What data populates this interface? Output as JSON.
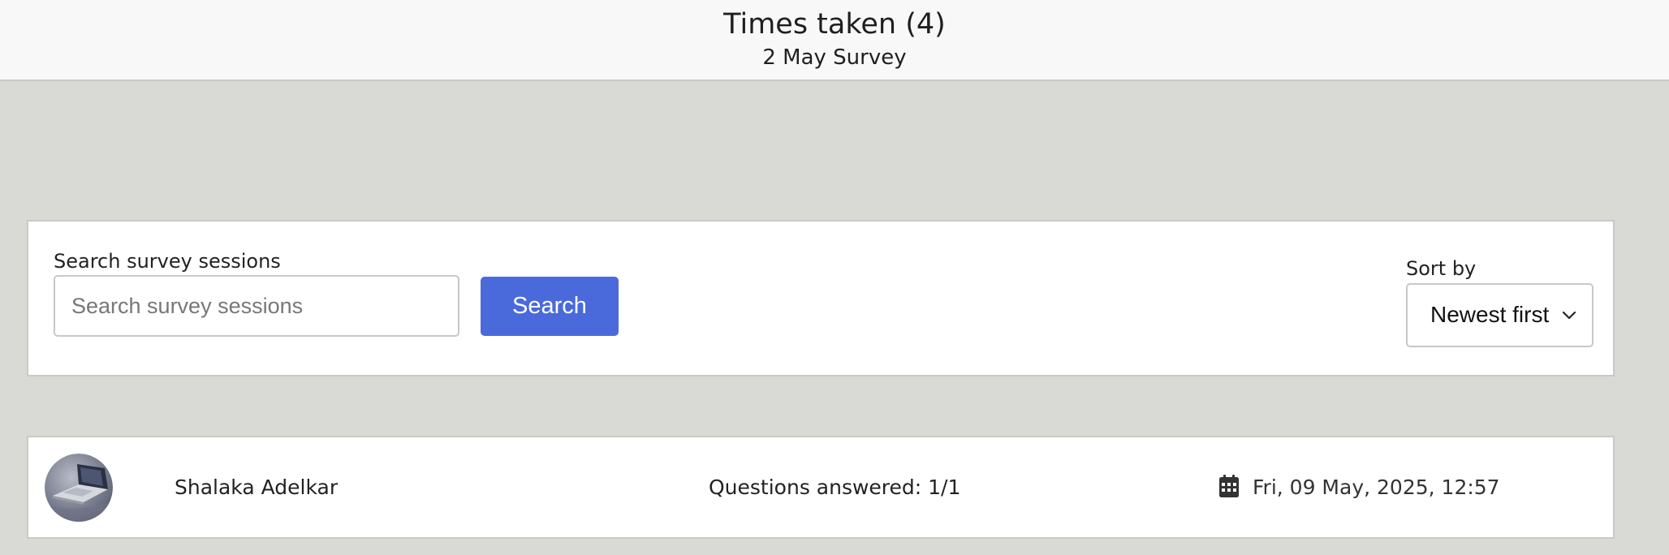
{
  "header": {
    "title": "Times taken (4)",
    "subtitle": "2 May Survey"
  },
  "search": {
    "label": "Search survey sessions",
    "placeholder": "Search survey sessions",
    "value": "",
    "button_label": "Search"
  },
  "sort": {
    "label": "Sort by",
    "selected": "Newest first"
  },
  "sessions": [
    {
      "name": "Shalaka Adelkar",
      "questions": "Questions answered: 1/1",
      "date": "Fri, 09 May, 2025, 12:57",
      "avatar_icon": "laptop-photo-avatar",
      "date_icon": "calendar-icon"
    }
  ],
  "colors": {
    "background": "#d9dad5",
    "header_bg": "#f8f8f9",
    "accent": "#4a6adc",
    "card_bg": "#ffffff"
  }
}
